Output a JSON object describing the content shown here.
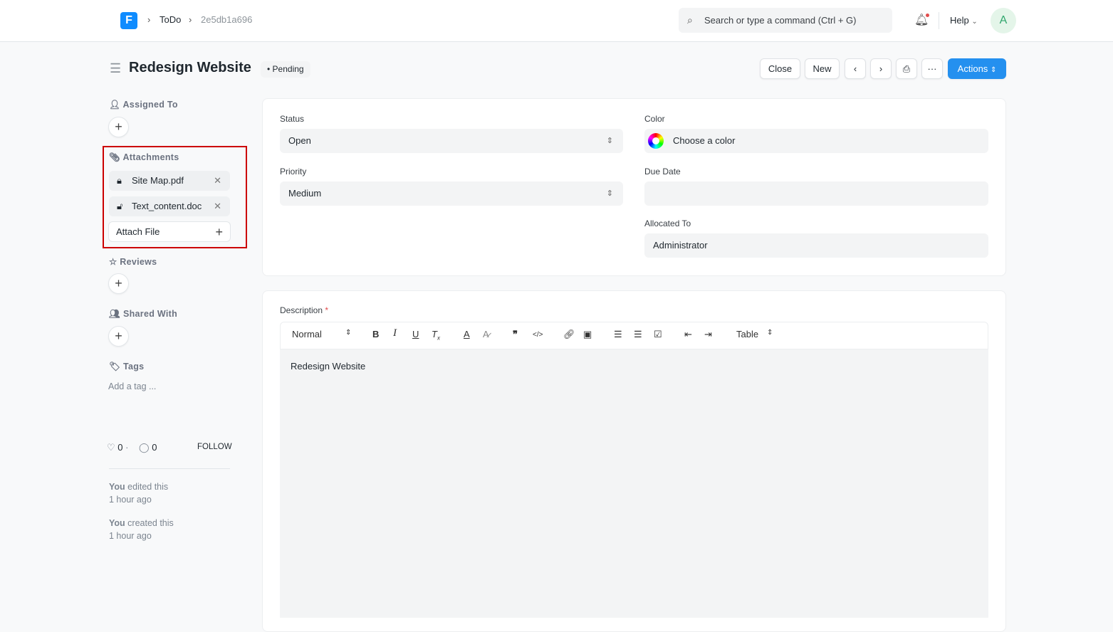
{
  "navbar": {
    "logo_letter": "F",
    "breadcrumbs": [
      "ToDo",
      "2e5db1a696"
    ],
    "search_placeholder": "Search or type a command (Ctrl + G)",
    "help_label": "Help",
    "avatar_initial": "A"
  },
  "header": {
    "title": "Redesign Website",
    "status_badge": "Pending",
    "buttons": {
      "close": "Close",
      "new": "New",
      "actions": "Actions"
    }
  },
  "sidebar": {
    "assigned_to": "Assigned To",
    "attachments": {
      "label": "Attachments",
      "files": [
        "Site Map.pdf",
        "Text_content.doc"
      ],
      "attach_label": "Attach File"
    },
    "reviews": "Reviews",
    "shared_with": "Shared With",
    "tags": "Tags",
    "add_tag": "Add a tag ...",
    "likes": "0",
    "comments": "0",
    "follow": "FOLLOW",
    "activity": [
      {
        "who": "You",
        "action": "edited this",
        "time": "1 hour ago"
      },
      {
        "who": "You",
        "action": "created this",
        "time": "1 hour ago"
      }
    ]
  },
  "form": {
    "status": {
      "label": "Status",
      "value": "Open"
    },
    "priority": {
      "label": "Priority",
      "value": "Medium"
    },
    "color": {
      "label": "Color",
      "value": "Choose a color"
    },
    "due_date": {
      "label": "Due Date",
      "value": ""
    },
    "allocated_to": {
      "label": "Allocated To",
      "value": "Administrator"
    },
    "description": {
      "label": "Description",
      "required": "*",
      "format": "Normal",
      "table": "Table",
      "content": "Redesign Website"
    }
  },
  "colors": {
    "accent": "#2490ef",
    "highlight": "#cc0000"
  }
}
